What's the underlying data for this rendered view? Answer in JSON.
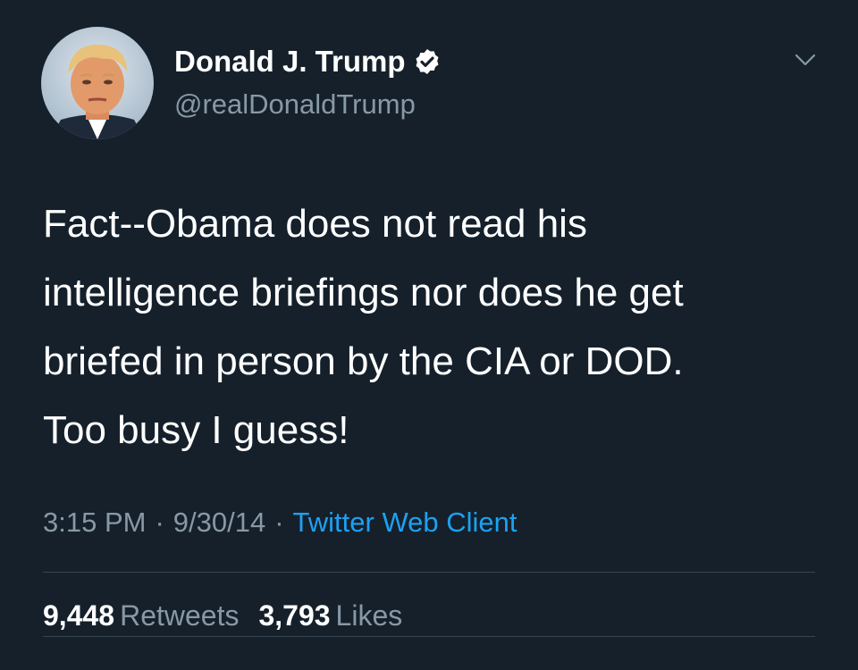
{
  "author": {
    "display_name": "Donald J. Trump",
    "handle": "@realDonaldTrump",
    "verified": true,
    "avatar_icon": "profile-photo"
  },
  "tweet": {
    "text": "Fact--Obama does not read his\nintelligence briefings nor does he get\nbriefed in person by the CIA or DOD.\nToo busy I guess!"
  },
  "meta": {
    "time": "3:15 PM",
    "separator": "·",
    "date": "9/30/14",
    "source": "Twitter Web Client"
  },
  "stats": {
    "retweets_count": "9,448",
    "retweets_label": "Retweets",
    "likes_count": "3,793",
    "likes_label": "Likes"
  },
  "colors": {
    "background": "#15202b",
    "text_primary": "#ffffff",
    "text_secondary": "#8899a6",
    "link": "#1da1f2",
    "divider": "#38444d"
  }
}
